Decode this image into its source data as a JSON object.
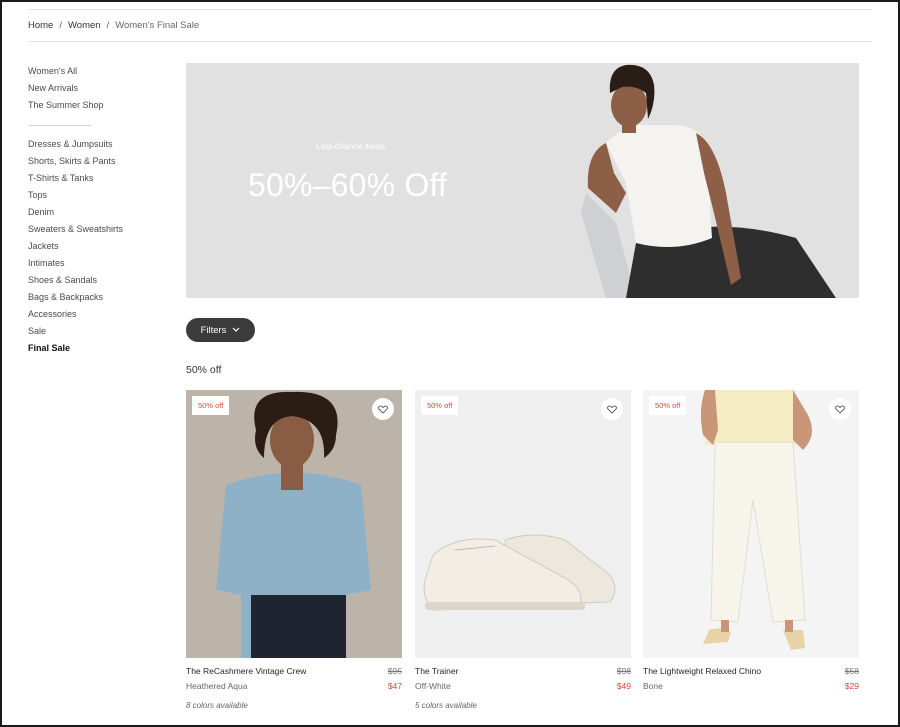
{
  "breadcrumb": {
    "home": "Home",
    "sep": "/",
    "women": "Women",
    "current": "Women's Final Sale"
  },
  "sidebar": {
    "top_items": [
      "Women's All",
      "New Arrivals",
      "The Summer Shop"
    ],
    "categories": [
      "Dresses & Jumpsuits",
      "Shorts, Skirts & Pants",
      "T-Shirts & Tanks",
      "Tops",
      "Denim",
      "Sweaters & Sweatshirts",
      "Jackets",
      "Intimates",
      "Shoes & Sandals",
      "Bags & Backpacks",
      "Accessories",
      "Sale"
    ],
    "active": "Final Sale"
  },
  "hero": {
    "eyebrow": "Last-chance items.",
    "headline": "50%–60% Off"
  },
  "filters": {
    "label": "Filters",
    "icon": "chevron-down-icon"
  },
  "section": {
    "title": "50% off"
  },
  "products": [
    {
      "badge": "50% off",
      "name": "The ReCashmere Vintage Crew",
      "old_price": "$95",
      "color": "Heathered Aqua",
      "price": "$47",
      "availability": "8 colors available"
    },
    {
      "badge": "50% off",
      "name": "The Trainer",
      "old_price": "$98",
      "color": "Off-White",
      "price": "$49",
      "availability": "5 colors available"
    },
    {
      "badge": "50% off",
      "name": "The Lightweight Relaxed Chino",
      "old_price": "$58",
      "color": "Bone",
      "price": "$29",
      "availability": ""
    }
  ],
  "colors": {
    "accent_sale": "#d54b3a",
    "button_dark": "#3b3b3b",
    "hero_bg": "#e1e1e1"
  }
}
